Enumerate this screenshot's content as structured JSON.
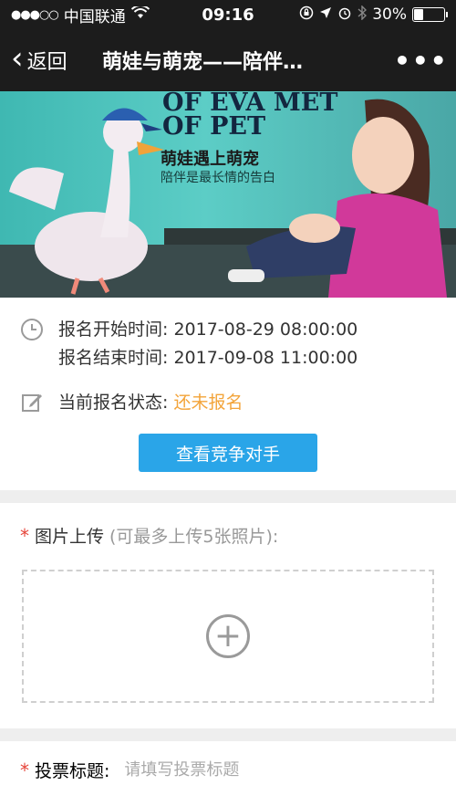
{
  "status_bar": {
    "carrier": "中国联通",
    "signal": "●●●○○",
    "time": "09:16",
    "battery": "30%",
    "battery_level": 0.3
  },
  "nav": {
    "back_label": "返回",
    "title": "萌娃与萌宠——陪伴…",
    "more_label": "•••"
  },
  "banner": {
    "en_line1": "OF EVA MET",
    "en_line2": "OF PET",
    "cn_title": "萌娃遇上萌宠",
    "cn_subtitle": "陪伴是最长情的告白"
  },
  "registration": {
    "start_label": "报名开始时间:",
    "start_value": "2017-08-29 08:00:00",
    "end_label": "报名结束时间:",
    "end_value": "2017-09-08 11:00:00",
    "status_label": "当前报名状态:",
    "status_value": "还未报名",
    "status_color": "#f3a43a",
    "rival_button": "查看竞争对手"
  },
  "upload": {
    "required_mark": "*",
    "label": "图片上传",
    "hint": "(可最多上传5张照片):"
  },
  "vote_title": {
    "required_mark": "*",
    "label": "投票标题:",
    "placeholder": "请填写投票标题"
  }
}
